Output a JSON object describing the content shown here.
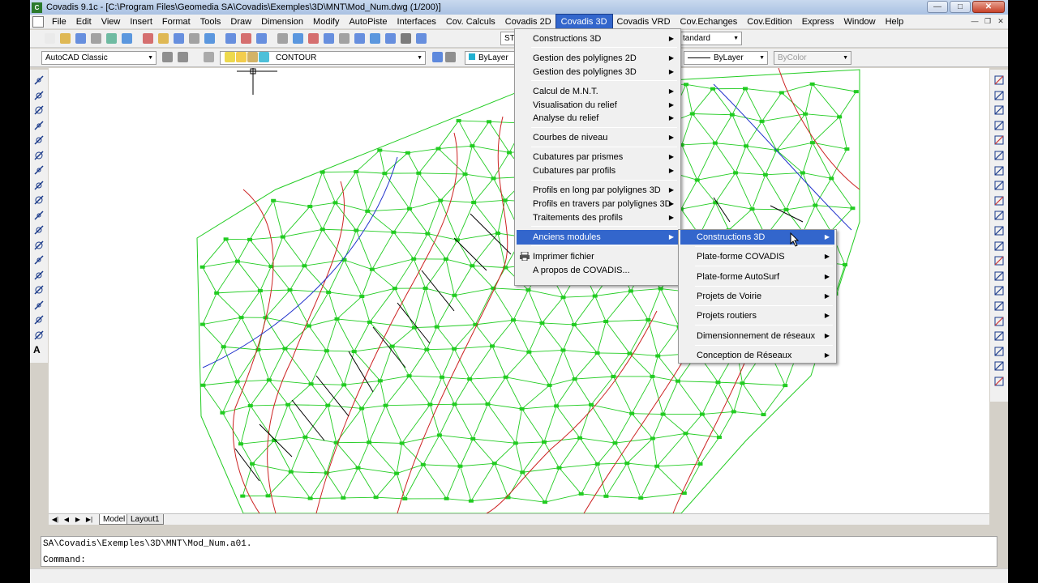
{
  "window": {
    "title": "Covadis 9.1c - [C:\\Program Files\\Geomedia SA\\Covadis\\Exemples\\3D\\MNT\\Mod_Num.dwg (1/200)]",
    "app_icon": "C"
  },
  "menubar": [
    "File",
    "Edit",
    "View",
    "Insert",
    "Format",
    "Tools",
    "Draw",
    "Dimension",
    "Modify",
    "AutoPiste",
    "Interfaces",
    "Cov. Calculs",
    "Covadis 2D",
    "Covadis 3D",
    "Covadis VRD",
    "Cov.Echanges",
    "Cov.Edition",
    "Express",
    "Window",
    "Help"
  ],
  "active_menu": "Covadis 3D",
  "toolbar1": {
    "text_style_combo": "STA",
    "dim_style_combo": "tandard"
  },
  "toolbar2": {
    "workspace": "AutoCAD Classic",
    "layer": "CONTOUR",
    "color": "ByLayer",
    "linetype": "ByLayer",
    "plotstyle": "ByColor"
  },
  "covadis3d_menu": [
    {
      "label": "Constructions 3D",
      "sub": true
    },
    {
      "label": "Gestion des polylignes 2D",
      "sub": true
    },
    {
      "label": "Gestion des polylignes 3D",
      "sub": true
    },
    {
      "label": "Calcul de M.N.T.",
      "sub": true
    },
    {
      "label": "Visualisation du relief",
      "sub": true
    },
    {
      "label": "Analyse du relief",
      "sub": true
    },
    {
      "label": "Courbes de niveau",
      "sub": true
    },
    {
      "label": "Cubatures par prismes",
      "sub": true
    },
    {
      "label": "Cubatures par profils",
      "sub": true
    },
    {
      "label": "Profils en long par polylignes 3D",
      "sub": true
    },
    {
      "label": "Profils en travers par polylignes 3D",
      "sub": true
    },
    {
      "label": "Traitements des profils",
      "sub": true
    },
    {
      "label": "Anciens modules",
      "sub": true
    },
    {
      "label": "Imprimer fichier",
      "sub": false
    },
    {
      "label": "A propos de COVADIS...",
      "sub": false
    }
  ],
  "anciens_submenu": [
    {
      "label": "Constructions 3D",
      "sub": true
    },
    {
      "label": "Plate-forme COVADIS",
      "sub": true
    },
    {
      "label": "Plate-forme AutoSurf",
      "sub": true
    },
    {
      "label": "Projets de Voirie",
      "sub": true
    },
    {
      "label": "Projets routiers",
      "sub": true
    },
    {
      "label": "Dimensionnement de réseaux",
      "sub": true
    },
    {
      "label": "Conception de Réseaux",
      "sub": true
    }
  ],
  "layout_tabs": [
    "Model",
    "Layout1"
  ],
  "command": {
    "history": "SA\\Covadis\\Exemples\\3D\\MNT\\Mod_Num.a01.",
    "prompt": "Command:"
  },
  "colors": {
    "tin": "#22cc22",
    "contour_red": "#cc2222",
    "breakline_blue": "#2233cc",
    "menu_highlight": "#3366cc"
  }
}
